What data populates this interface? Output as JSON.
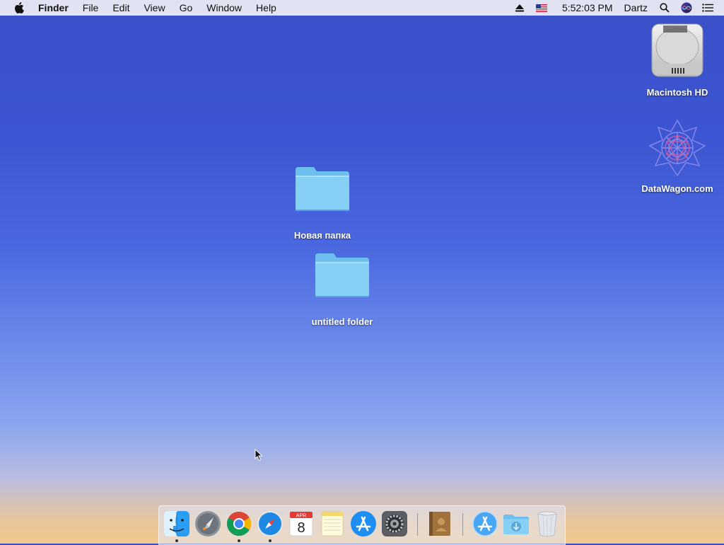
{
  "menubar": {
    "app_name": "Finder",
    "menus": [
      "File",
      "Edit",
      "View",
      "Go",
      "Window",
      "Help"
    ],
    "time": "5:52:03 PM",
    "user": "Dartz",
    "icons": [
      "apple-icon",
      "eject-icon",
      "flag-us-icon",
      "search-icon",
      "siri-icon",
      "notification-center-icon"
    ]
  },
  "desktop": {
    "items": [
      {
        "label": "Macintosh HD",
        "icon": "hard-drive-icon"
      },
      {
        "label": "DataWagon.com",
        "icon": "network-volume-icon"
      },
      {
        "label": "Новая папка",
        "icon": "folder-icon"
      },
      {
        "label": "untitled folder",
        "icon": "folder-icon"
      }
    ]
  },
  "dock": {
    "apps": [
      {
        "name": "finder-icon",
        "running": true
      },
      {
        "name": "launchpad-icon",
        "running": false
      },
      {
        "name": "chrome-icon",
        "running": true
      },
      {
        "name": "safari-icon",
        "running": true
      },
      {
        "name": "calendar-icon",
        "running": false,
        "month": "APR",
        "day": "8"
      },
      {
        "name": "notes-icon",
        "running": false
      },
      {
        "name": "app-store-icon",
        "running": false
      },
      {
        "name": "system-preferences-icon",
        "running": false
      },
      {
        "name": "contacts-book-icon",
        "running": false
      },
      {
        "name": "applications-folder-icon",
        "running": false
      },
      {
        "name": "downloads-folder-icon",
        "running": false
      },
      {
        "name": "trash-icon",
        "running": false
      }
    ]
  },
  "colors": {
    "folder": "#7fcdf5",
    "menubar_bg": "#f0f0f5",
    "label_text": "#ffffff"
  }
}
